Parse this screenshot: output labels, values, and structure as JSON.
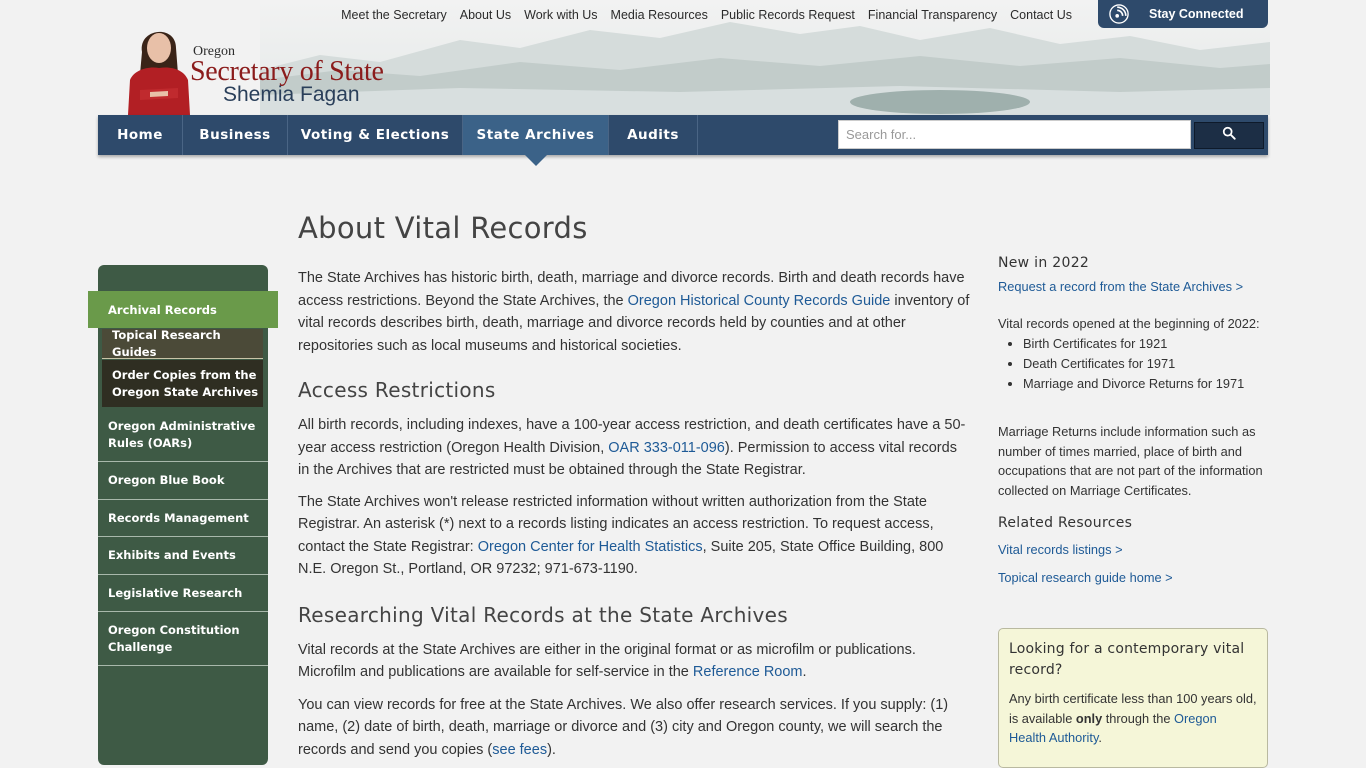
{
  "header": {
    "logo": {
      "state": "Oregon",
      "title": "Secretary of State",
      "name": "Shemia Fagan"
    },
    "utility_links": [
      "Meet the Secretary",
      "About Us",
      "Work with Us",
      "Media Resources",
      "Public Records Request",
      "Financial Transparency",
      "Contact Us"
    ],
    "stay_connected": "Stay Connected"
  },
  "nav": {
    "tabs": [
      {
        "label": "Home"
      },
      {
        "label": "Business"
      },
      {
        "label": "Voting & Elections"
      },
      {
        "label": "State Archives"
      },
      {
        "label": "Audits"
      }
    ],
    "active_tab": "State Archives",
    "search_placeholder": "Search for...",
    "search_icon": "magnifier-icon"
  },
  "sidebar": {
    "active": "Archival Records",
    "sub_items": [
      "Topical Research Guides",
      "Order Copies from the Oregon State Archives"
    ],
    "items": [
      "Oregon Administrative Rules (OARs)",
      "Oregon Blue Book",
      "Records Management",
      "Exhibits and Events",
      "Legislative Research",
      "Oregon Constitution Challenge"
    ]
  },
  "main": {
    "title": "About Vital Records",
    "intro": {
      "t1": "The State Archives has historic birth, death, marriage and divorce records. Birth and death records have access restrictions. Beyond the State Archives, the ",
      "link": "Oregon Historical County Records Guide",
      "t2": " inventory of vital records describes birth, death, marriage and divorce records held by counties and at other repositories such as local museums and historical societies."
    },
    "h_access": "Access Restrictions",
    "access1": {
      "t1": "All birth records, including indexes, have a 100-year access restriction, and death certificates have a 50-year access restriction (Oregon Health Division, ",
      "link": "OAR 333-011-096",
      "t2": "). Permission to access vital records in the Archives that are restricted must be obtained through the State Registrar."
    },
    "access2": {
      "t1": "The State Archives won't release restricted information without written authorization from the State Registrar. An asterisk (*) next to a records listing indicates an access restriction. To request access, contact the State Registrar: ",
      "link": "Oregon Center for Health Statistics",
      "t2": ", Suite 205, State Office Building, 800 N.E. Oregon St., Portland, OR 97232; 971-673-1190."
    },
    "h_research": "Researching Vital Records at the State Archives",
    "research1": {
      "t1": "Vital records at the State Archives are either in the original format or as microfilm or publications. Microfilm and publications are available for self-service in the ",
      "link": "Reference Room",
      "t2": "."
    },
    "research2": {
      "t1": "You can view records for free at the State Archives. We also offer research services. If you supply: (1) name, (2) date of birth, death, marriage or divorce and (3) city and Oregon county, we will search the records and send you copies (",
      "link": "see fees",
      "t2": ")."
    }
  },
  "right": {
    "new_title": "New in 2022",
    "request_link": "Request a record from the State Archives >",
    "opened_text": "Vital records opened at the beginning of 2022:",
    "opened_list": [
      "Birth Certificates for 1921",
      "Death Certificates for 1971",
      "Marriage and Divorce Returns for 1971"
    ],
    "marriage_text": "Marriage Returns include information such as number of times married, place of birth and occupations that are not part of the information collected on Marriage Certificates.",
    "related_title": "Related Resources",
    "related_links": [
      "Vital records listings >",
      "Topical research guide home >"
    ],
    "callout": {
      "title": "Looking for a contemporary vital record?",
      "t1": "Any birth certificate less than 100 years old, is available ",
      "bold": "only",
      "t2": " through the ",
      "link": "Oregon Health Authority",
      "t3": "."
    }
  },
  "colors": {
    "nav_bg": "#2e4a6b",
    "nav_active": "#3b6288",
    "sidebar_bg": "#3e5a45",
    "sidebar_active": "#6a9a4a",
    "sidebar_sub": "#4b4a38",
    "link": "#1e5a96",
    "logo_red": "#8b1c1c",
    "callout_bg": "#f5f6d8"
  }
}
